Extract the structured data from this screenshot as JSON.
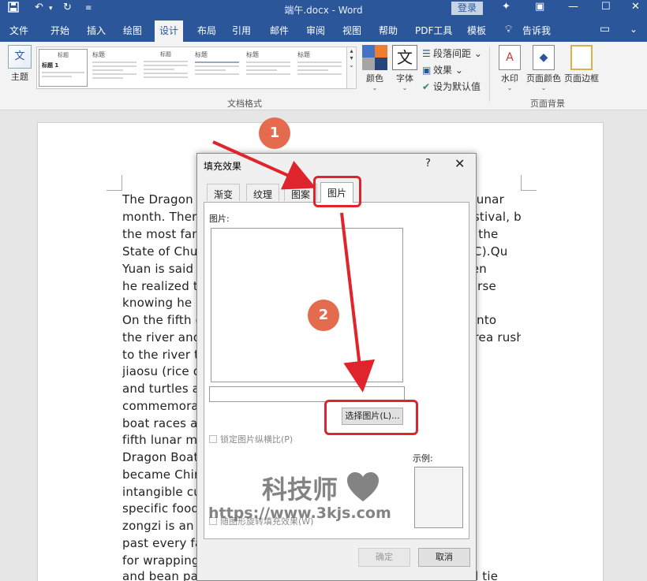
{
  "titlebar": {
    "doc_title": "端午.docx  -  Word",
    "login": "登录"
  },
  "tabs": [
    "文件",
    "开始",
    "插入",
    "绘图",
    "设计",
    "布局",
    "引用",
    "邮件",
    "审阅",
    "视图",
    "帮助",
    "PDF工具",
    "模板"
  ],
  "active_tab": "设计",
  "tell_me": "告诉我",
  "ribbon": {
    "theme_label": "主题",
    "thumb_titles": [
      "标题",
      "标题",
      "标题",
      "标题",
      "标题",
      "标题"
    ],
    "first_thumb_heading": "标题 1",
    "group_doc_format": "文档格式",
    "colors_label": "颜色",
    "fonts_label": "字体",
    "paragraph_spacing": "段落间距",
    "effects": "效果",
    "set_default": "设为默认值",
    "watermark_label": "水印",
    "page_color_label": "页面颜色",
    "page_border_label": "页面边框",
    "group_page_bg": "页面背景"
  },
  "document_lines": [
    "The Dragon Boat Festival falls on the fifth day of the fifth lunar",
    "month. There are many legends about the origin of the festival, but",
    "the most famous one is about Qu Yuan, a patriotic poet of the",
    "State of Chu during the Warring States period (475–221 BC).Qu",
    "Yuan is said to have been a loyal minister of the king. When",
    "he realized the state was doomed, he was filled with remorse",
    "knowing he could not save it as the enemy grew stronger.",
    "On the fifth day of the fifth lunar month he threw himself into",
    "the river and drowned. People who lived in the adjacent area rushed",
    "to the river to try to save him. To prevent fish, they threw",
    "jiaosu (rice dumplings) into the river to keep fish",
    "and turtles away from his body. Later, to",
    "commemorate Qu Yuan, people began holding dragon",
    "boat races and eating zongzi on the fifth day of",
    "fifth lunar month every year, giving rise to the name",
    "Dragon Boat Festival. In 2009, the Dragon Boat Festival",
    "became China's first festival to be included in the world's",
    "intangible cultural heritage list. People tend to relate to",
    "specific foods with specific festivals in China. The",
    "zongzi is an important food of the festival. In the",
    "past every family made zongzi themselves, using leaves",
    "for wrapping, including sweet ones with jujube",
    "and bean paste or savory ones like fresh meat or ham and tie"
  ],
  "dialog": {
    "title": "填充效果",
    "help": "?",
    "close": "✕",
    "tabs": [
      "渐变",
      "纹理",
      "图案",
      "图片"
    ],
    "active_tab": "图片",
    "picture_label": "图片:",
    "choose_button": "选择图片(L)...",
    "lock_aspect": "锁定图片纵横比(P)",
    "rotate_with_shape": "随图形旋转填充效果(W)",
    "sample_label": "示例:",
    "ok": "确定",
    "cancel": "取消"
  },
  "annotations": {
    "badge1": "1",
    "badge2": "2",
    "accent_color": "#e0242b",
    "badge_color": "#e46b4e"
  },
  "watermark": {
    "text": "科技师",
    "url": "https://www.3kjs.com"
  },
  "colors": {
    "title_bar": "#2b579a",
    "ribbon_bg": "#f3f3f3"
  }
}
